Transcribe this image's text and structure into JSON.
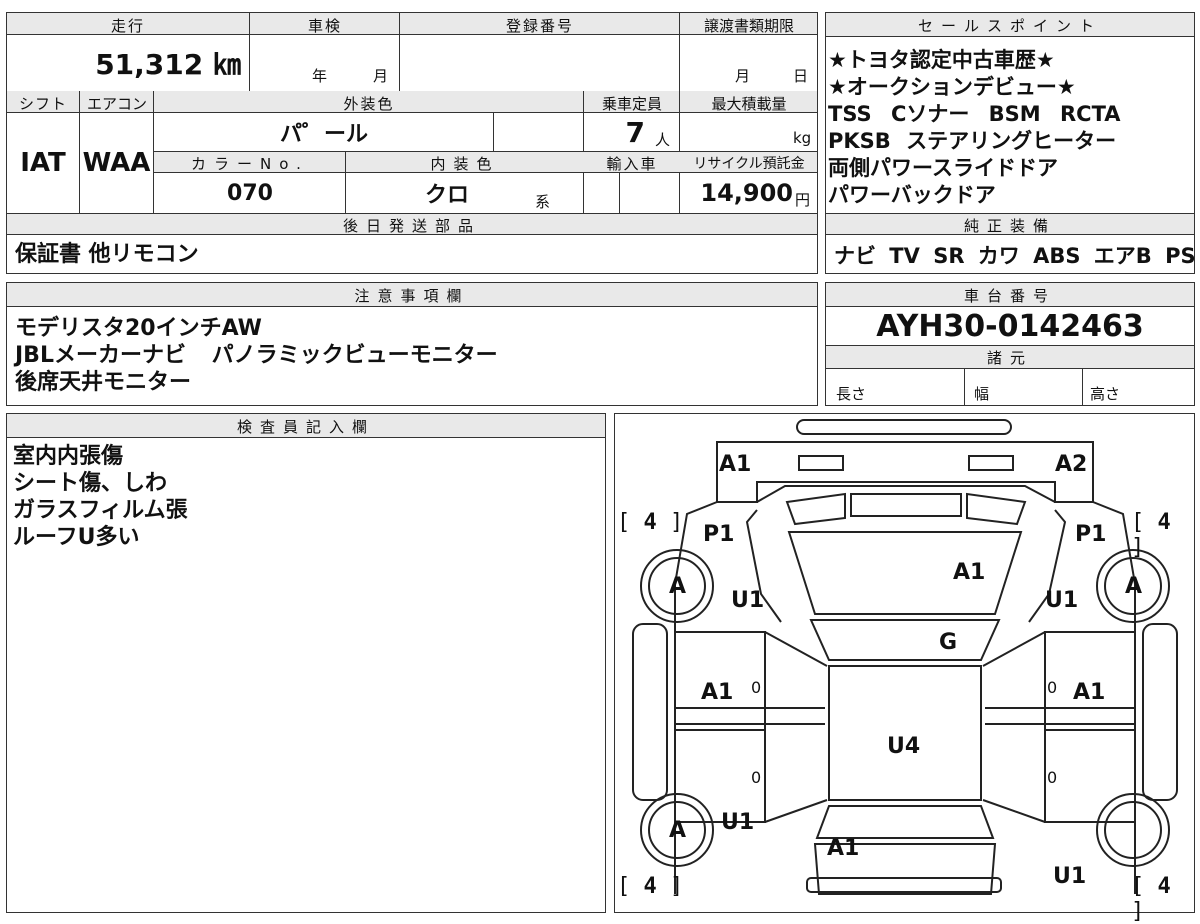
{
  "top_left": {
    "headers": {
      "mileage": "走行",
      "shaken": "車検",
      "registration_no": "登録番号",
      "transfer_deadline": "譲渡書類期限"
    },
    "mileage_value": "51,312 ㎞",
    "shaken_year_unit": "年",
    "shaken_month_unit": "月",
    "transfer_month_unit": "月",
    "transfer_day_unit": "日",
    "shift_label": "シフト",
    "aircon_label": "エアコン",
    "exterior_color_label": "外装色",
    "capacity_label": "乗車定員",
    "max_load_label": "最大積載量",
    "shift_value": "IAT",
    "aircon_value": "WAA",
    "exterior_color_value": "パ゜ール",
    "capacity_value": "7",
    "capacity_unit": "人",
    "load_unit": "kg",
    "color_no_label": "カラーNo.",
    "interior_color_label": "内装色",
    "import_label": "輸入車",
    "recycle_label": "リサイクル預託金",
    "color_no_value": "070",
    "interior_color_value": "クロ",
    "interior_suffix": "系",
    "recycle_value": "14,900",
    "recycle_unit": "円",
    "later_parts_label": "後日発送部品",
    "later_parts_value": "保証書 他リモコン"
  },
  "sales": {
    "header": "セールスポイント",
    "lines": [
      "★トヨタ認定中古車歴★",
      "★オークションデビュー★",
      "TSS Cソナー BSM RCTA",
      "PKSB ステアリングヒーター",
      "両側パワースライドドア",
      "パワーバックドア"
    ],
    "equipment_header": "純正装備",
    "equipment": "ナビ TV SR カワ ABS エアB PS PW"
  },
  "notes": {
    "header": "注意事項欄",
    "lines": [
      "モデリスタ20インチAW",
      "JBLメーカーナビ パノラミックビューモニター",
      "後席天井モニター"
    ]
  },
  "chassis": {
    "header": "車台番号",
    "value": "AYH30-0142463",
    "spec_header": "諸元",
    "length_label": "長さ",
    "width_label": "幅",
    "height_label": "高さ"
  },
  "inspector": {
    "header": "検査員記入欄",
    "lines": [
      "室内内張傷",
      "シート傷、しわ",
      "ガラスフィルム張",
      "ルーフU多い"
    ]
  },
  "diagram": {
    "marks": {
      "front_left": "A1",
      "front_right": "A2",
      "fender_l": "P1",
      "fender_r": "P1",
      "wheel": "A",
      "u1": "U1",
      "hood": "A1",
      "windshield": "G",
      "door_l": "A1",
      "door_r": "A1",
      "roof": "U4",
      "rear": "A1",
      "zero": "0"
    },
    "tire_depth": "4"
  }
}
